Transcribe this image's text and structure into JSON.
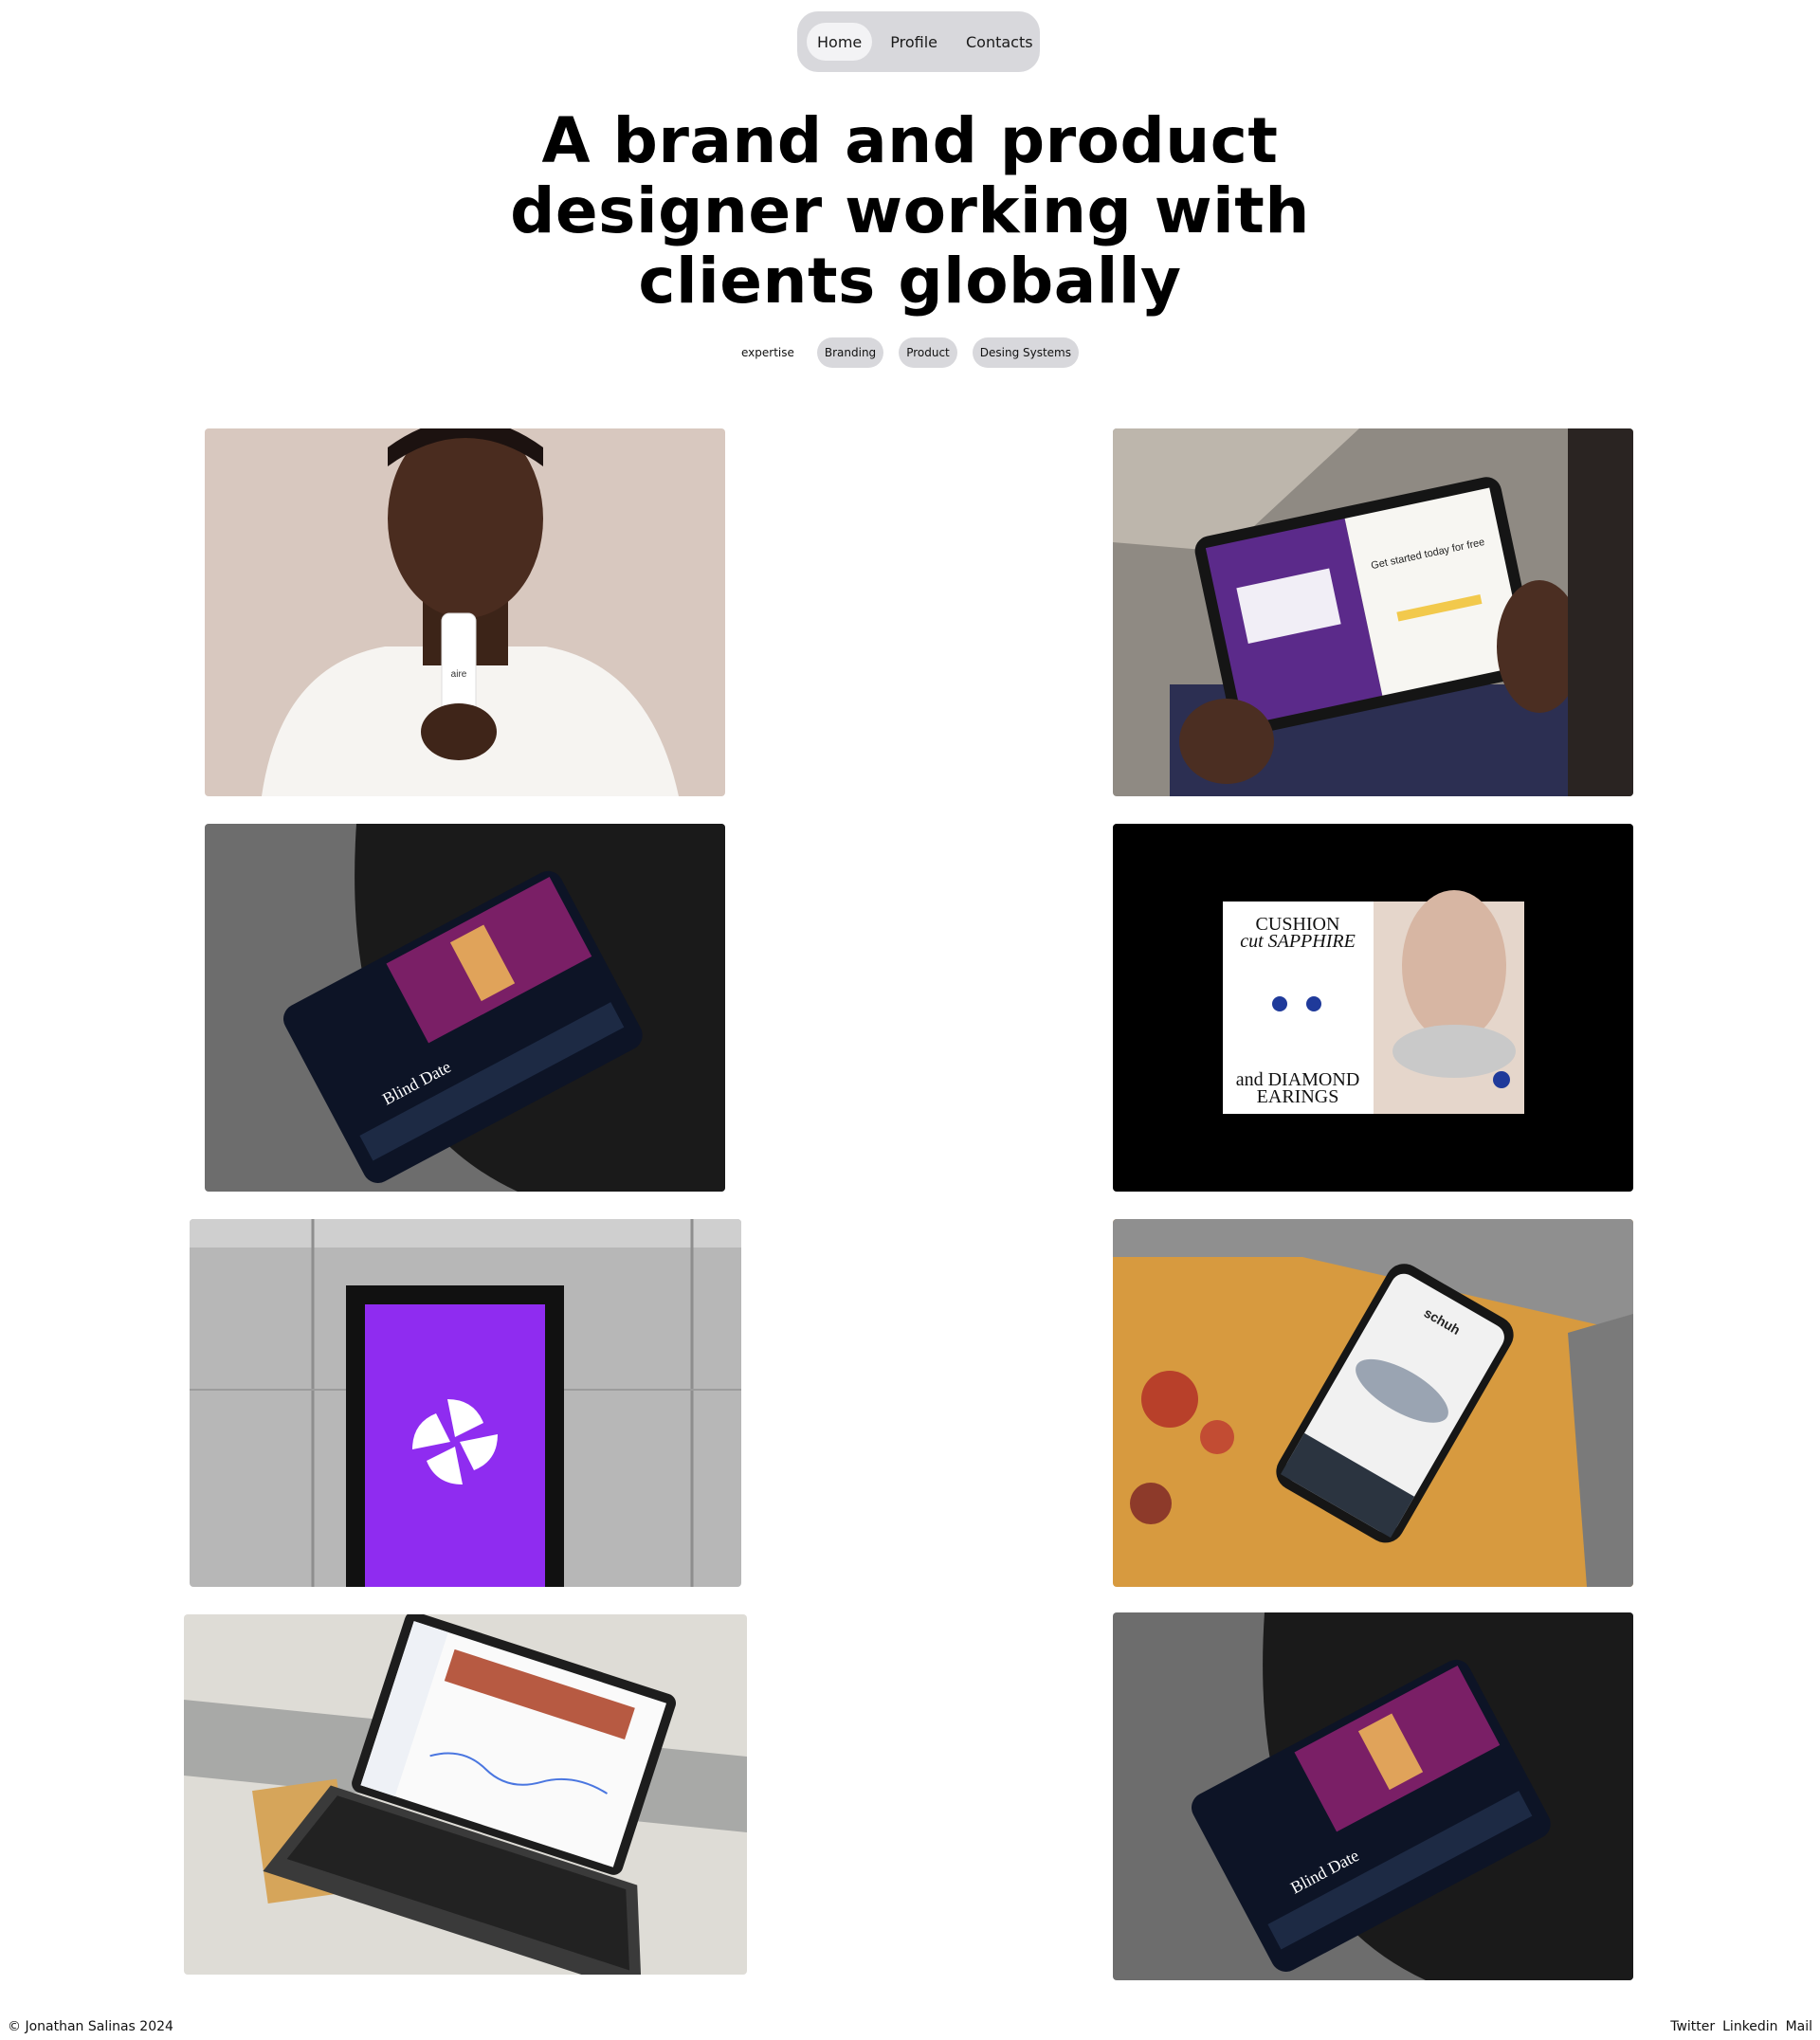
{
  "nav": {
    "items": [
      {
        "label": "Home",
        "active": true
      },
      {
        "label": "Profile",
        "active": false
      },
      {
        "label": "Contacts",
        "active": false
      }
    ]
  },
  "hero": {
    "lines": [
      "A brand and product",
      "designer working with",
      "clients globally"
    ]
  },
  "expertise": {
    "label": "expertise",
    "tags": [
      "Branding",
      "Product",
      "Desing Systems"
    ]
  },
  "gallery": {
    "projects": [
      {
        "subject": "skincare-model",
        "label": "aire"
      },
      {
        "subject": "tablet-signup",
        "label": "Get started today for free"
      },
      {
        "subject": "tablet-streaming",
        "label": "Blind Date"
      },
      {
        "subject": "jewellery-ad",
        "label_line1": "CUSHION",
        "label_line2": "cut SAPPHIRE",
        "label_line3": "and DIAMOND",
        "label_line4": "EARINGS"
      },
      {
        "subject": "purple-kiosk",
        "label": ""
      },
      {
        "subject": "phone-shop",
        "label": "schuh"
      },
      {
        "subject": "laptop-dashboard",
        "label": ""
      },
      {
        "subject": "tablet-streaming-2",
        "label": "Blind Date"
      }
    ]
  },
  "footer": {
    "copyright": "© Jonathan Salinas 2024",
    "links": [
      "Twitter",
      "Linkedin",
      "Mail"
    ]
  }
}
